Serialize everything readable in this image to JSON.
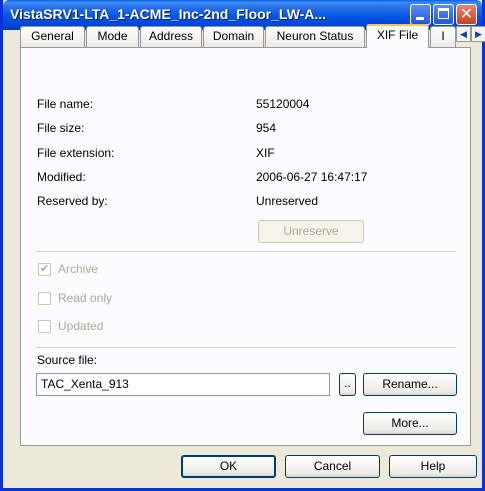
{
  "window": {
    "title": "VistaSRV1-LTA_1-ACME_Inc-2nd_Floor_LW-A..."
  },
  "tabs": [
    {
      "label": "General"
    },
    {
      "label": "Mode"
    },
    {
      "label": "Address"
    },
    {
      "label": "Domain"
    },
    {
      "label": "Neuron Status"
    },
    {
      "label": "XIF File"
    },
    {
      "label": "I"
    }
  ],
  "active_tab": "XIF File",
  "fields": [
    {
      "label": "File name:",
      "value": "55120004"
    },
    {
      "label": "File size:",
      "value": "954"
    },
    {
      "label": "File extension:",
      "value": "XIF"
    },
    {
      "label": "Modified:",
      "value": "2006-06-27 16:47:17"
    },
    {
      "label": "Reserved by:",
      "value": "Unreserved"
    }
  ],
  "unreserve_label": "Unreserve",
  "checkboxes": [
    {
      "label": "Archive",
      "checked": true,
      "enabled": false
    },
    {
      "label": "Read only",
      "checked": false,
      "enabled": false
    },
    {
      "label": "Updated",
      "checked": false,
      "enabled": false
    }
  ],
  "source": {
    "label": "Source file:",
    "value": "TAC_Xenta_913",
    "browse_label": "..",
    "rename_label": "Rename...",
    "more_label": "More..."
  },
  "footer": {
    "ok": "OK",
    "cancel": "Cancel",
    "help": "Help"
  },
  "colors": {
    "titlebar": "#0055E5",
    "active_tab_accent": "#FFC83C",
    "dialog_bg": "#ECE9D8"
  }
}
